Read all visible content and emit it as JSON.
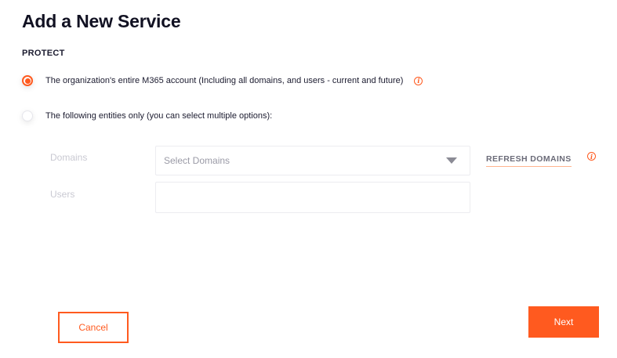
{
  "page": {
    "title": "Add a New Service",
    "section_label": "PROTECT"
  },
  "options": [
    {
      "label": "The organization's entire M365 account (Including all domains, and users - current and future)",
      "selected": true
    },
    {
      "label": "The following entities only (you can select multiple options):",
      "selected": false
    }
  ],
  "fields": {
    "domains_label": "Domains",
    "domains_placeholder": "Select Domains",
    "users_label": "Users",
    "refresh_label": "REFRESH DOMAINS"
  },
  "icons": {
    "info": "i",
    "info_icon_name": "info-circle-icon",
    "dropdown_icon_name": "caret-down-icon"
  },
  "buttons": {
    "cancel": "Cancel",
    "next": "Next"
  },
  "colors": {
    "accent": "#ff5a1f",
    "muted_label": "#c9c9d2",
    "link_underline": "#ffb48f"
  }
}
